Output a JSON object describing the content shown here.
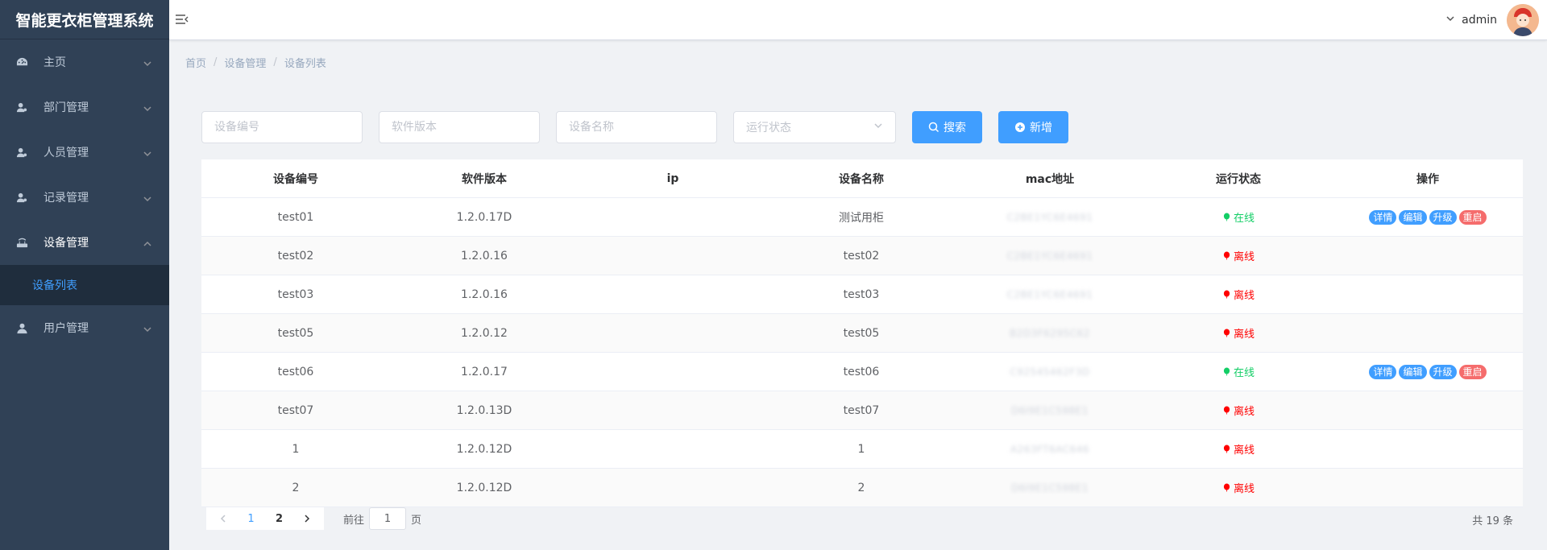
{
  "app": {
    "title": "智能更衣柜管理系统"
  },
  "sidebar": {
    "items": [
      {
        "label": "主页",
        "icon": "dashboard-icon",
        "expanded": false
      },
      {
        "label": "部门管理",
        "icon": "user-icon",
        "expanded": false
      },
      {
        "label": "人员管理",
        "icon": "user-icon",
        "expanded": false
      },
      {
        "label": "记录管理",
        "icon": "user-icon",
        "expanded": false
      },
      {
        "label": "设备管理",
        "icon": "router-icon",
        "expanded": true
      },
      {
        "label": "用户管理",
        "icon": "person-icon",
        "expanded": false
      }
    ],
    "active_sub": "设备列表"
  },
  "header": {
    "username": "admin"
  },
  "breadcrumb": [
    "首页",
    "设备管理",
    "设备列表"
  ],
  "filters": {
    "device_no_placeholder": "设备编号",
    "software_version_placeholder": "软件版本",
    "device_name_placeholder": "设备名称",
    "status_placeholder": "运行状态",
    "search_label": "搜索",
    "add_label": "新增"
  },
  "table": {
    "columns": [
      "设备编号",
      "软件版本",
      "ip",
      "设备名称",
      "mac地址",
      "运行状态",
      "操作"
    ],
    "rows": [
      {
        "no": "test01",
        "version": "1.2.0.17D",
        "ip": "",
        "name": "测试用柜",
        "mac": "C2BE1YC6E4691",
        "status": "在线",
        "online": true
      },
      {
        "no": "test02",
        "version": "1.2.0.16",
        "ip": "",
        "name": "test02",
        "mac": "C2BE1YC6E4691",
        "status": "离线",
        "online": false
      },
      {
        "no": "test03",
        "version": "1.2.0.16",
        "ip": "",
        "name": "test03",
        "mac": "C2BE1YC6E4691",
        "status": "离线",
        "online": false
      },
      {
        "no": "test05",
        "version": "1.2.0.12",
        "ip": "",
        "name": "test05",
        "mac": "B2D3F6295C62",
        "status": "离线",
        "online": false
      },
      {
        "no": "test06",
        "version": "1.2.0.17",
        "ip": "",
        "name": "test06",
        "mac": "C92545462F3D",
        "status": "在线",
        "online": true
      },
      {
        "no": "test07",
        "version": "1.2.0.13D",
        "ip": "",
        "name": "test07",
        "mac": "D6I9E1C598E1",
        "status": "离线",
        "online": false
      },
      {
        "no": "1",
        "version": "1.2.0.12D",
        "ip": "",
        "name": "1",
        "mac": "A263FT6AC646",
        "status": "离线",
        "online": false
      },
      {
        "no": "2",
        "version": "1.2.0.12D",
        "ip": "",
        "name": "2",
        "mac": "D6I9E1C598E1",
        "status": "离线",
        "online": false
      }
    ],
    "actions": [
      "详情",
      "编辑",
      "升级",
      "重启"
    ]
  },
  "pagination": {
    "pages": [
      "1",
      "2"
    ],
    "current": "1",
    "goto_prefix": "前往",
    "goto_value": "1",
    "goto_suffix": "页",
    "total_text": "共 19 条"
  },
  "colors": {
    "sidebar_bg": "#304156",
    "sidebar_active_bg": "#1f2d3d",
    "primary": "#409eff",
    "danger": "#f56c6c",
    "online": "#13ce66",
    "offline": "#ff0000"
  }
}
